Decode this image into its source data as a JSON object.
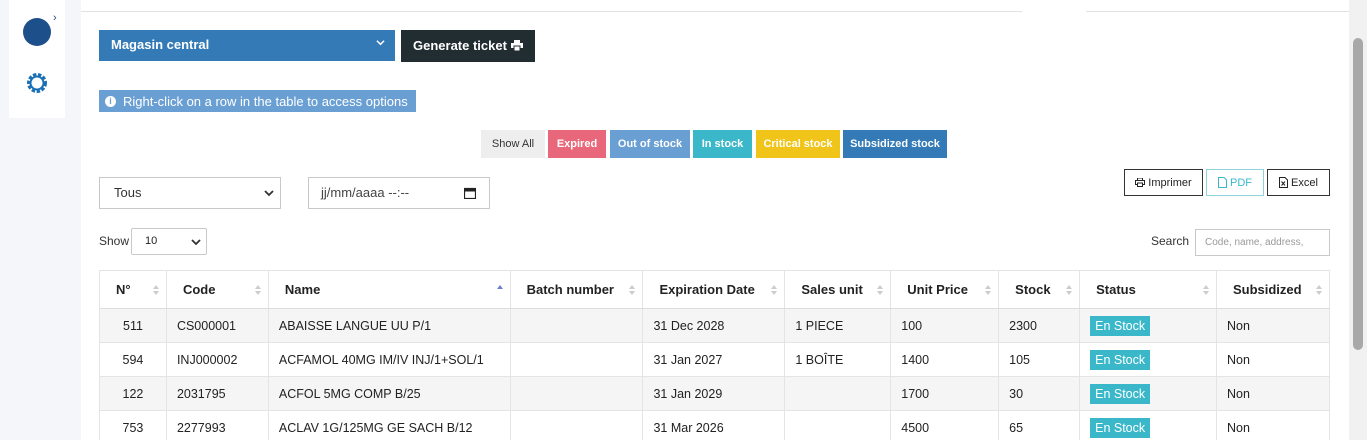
{
  "toolbar": {
    "store_select_value": "Magasin central",
    "generate_ticket_label": "Generate ticket"
  },
  "info_note": "Right-click on a row in the table to access options",
  "filters": {
    "show_all": "Show All",
    "expired": "Expired",
    "out_of_stock": "Out of stock",
    "in_stock": "In stock",
    "critical_stock": "Critical stock",
    "subsidized_stock": "Subsidized stock"
  },
  "filter_select_value": "Tous",
  "date_input_placeholder": "jj/mm/aaaa --:--",
  "export": {
    "print": "Imprimer",
    "pdf": "PDF",
    "excel": "Excel"
  },
  "table_controls": {
    "show_label": "Show",
    "page_size": "10",
    "search_label": "Search",
    "search_placeholder": "Code, name, address,"
  },
  "columns": [
    "N°",
    "Code",
    "Name",
    "Batch number",
    "Expiration Date",
    "Sales unit",
    "Unit Price",
    "Stock",
    "Status",
    "Subsidized"
  ],
  "rows": [
    {
      "num": "511",
      "code": "CS000001",
      "name": "ABAISSE LANGUE UU P/1",
      "batch": "",
      "expiry": "31 Dec 2028",
      "unit": "1 PIECE",
      "price": "100",
      "stock": "2300",
      "status": "En Stock",
      "subsidized": "Non"
    },
    {
      "num": "594",
      "code": "INJ000002",
      "name": "ACFAMOL 40MG IM/IV INJ/1+SOL/1",
      "batch": "",
      "expiry": "31 Jan 2027",
      "unit": "1 BOÎTE",
      "price": "1400",
      "stock": "105",
      "status": "En Stock",
      "subsidized": "Non"
    },
    {
      "num": "122",
      "code": "2031795",
      "name": "ACFOL 5MG COMP B/25",
      "batch": "",
      "expiry": "31 Jan 2029",
      "unit": "",
      "price": "1700",
      "stock": "30",
      "status": "En Stock",
      "subsidized": "Non"
    },
    {
      "num": "753",
      "code": "2277993",
      "name": "ACLAV 1G/125MG GE SACH B/12",
      "batch": "",
      "expiry": "31 Mar 2026",
      "unit": "",
      "price": "4500",
      "stock": "65",
      "status": "En Stock",
      "subsidized": "Non"
    }
  ],
  "colors": {
    "primary": "#337ab7",
    "dark": "#222d32",
    "expired": "#e8677a",
    "out_of_stock": "#6a9fd4",
    "in_stock": "#3ab8c9",
    "critical": "#f0c419"
  }
}
